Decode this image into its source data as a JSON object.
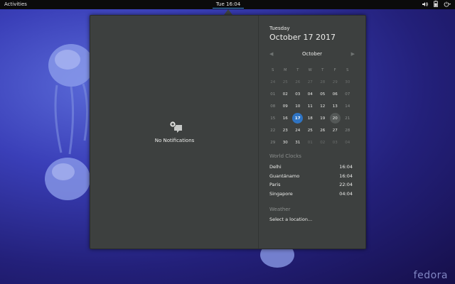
{
  "topbar": {
    "activities": "Activities",
    "clock": "Tue 16:04",
    "status_icons": [
      "volume-icon",
      "battery-icon",
      "power-menu-icon"
    ]
  },
  "notifications": {
    "empty_label": "No Notifications",
    "icon": "no-notifications-icon"
  },
  "calendar": {
    "weekday": "Tuesday",
    "date": "October 17 2017",
    "month": "October",
    "weekday_headers": [
      "S",
      "M",
      "T",
      "W",
      "T",
      "F",
      "S"
    ],
    "weeks": [
      [
        "24",
        "25",
        "26",
        "27",
        "28",
        "29",
        "30"
      ],
      [
        "01",
        "02",
        "03",
        "04",
        "05",
        "06",
        "07"
      ],
      [
        "08",
        "09",
        "10",
        "11",
        "12",
        "13",
        "14"
      ],
      [
        "15",
        "16",
        "17",
        "18",
        "19",
        "20",
        "21"
      ],
      [
        "22",
        "23",
        "24",
        "25",
        "26",
        "27",
        "28"
      ],
      [
        "29",
        "30",
        "31",
        "01",
        "02",
        "03",
        "04"
      ]
    ],
    "today": "17"
  },
  "world_clocks": {
    "title": "World Clocks",
    "items": [
      {
        "city": "Delhi",
        "time": "16:04"
      },
      {
        "city": "Guantánamo",
        "time": "16:04"
      },
      {
        "city": "Paris",
        "time": "22:04"
      },
      {
        "city": "Singapore",
        "time": "04:04"
      }
    ]
  },
  "weather": {
    "title": "Weather",
    "subtitle": "Select a location..."
  },
  "wallpaper": {
    "logo": "fedora"
  },
  "colors": {
    "accent": "#2f74c3",
    "popup_bg": "#3d403f",
    "topbar_bg": "#0b0b0b"
  }
}
